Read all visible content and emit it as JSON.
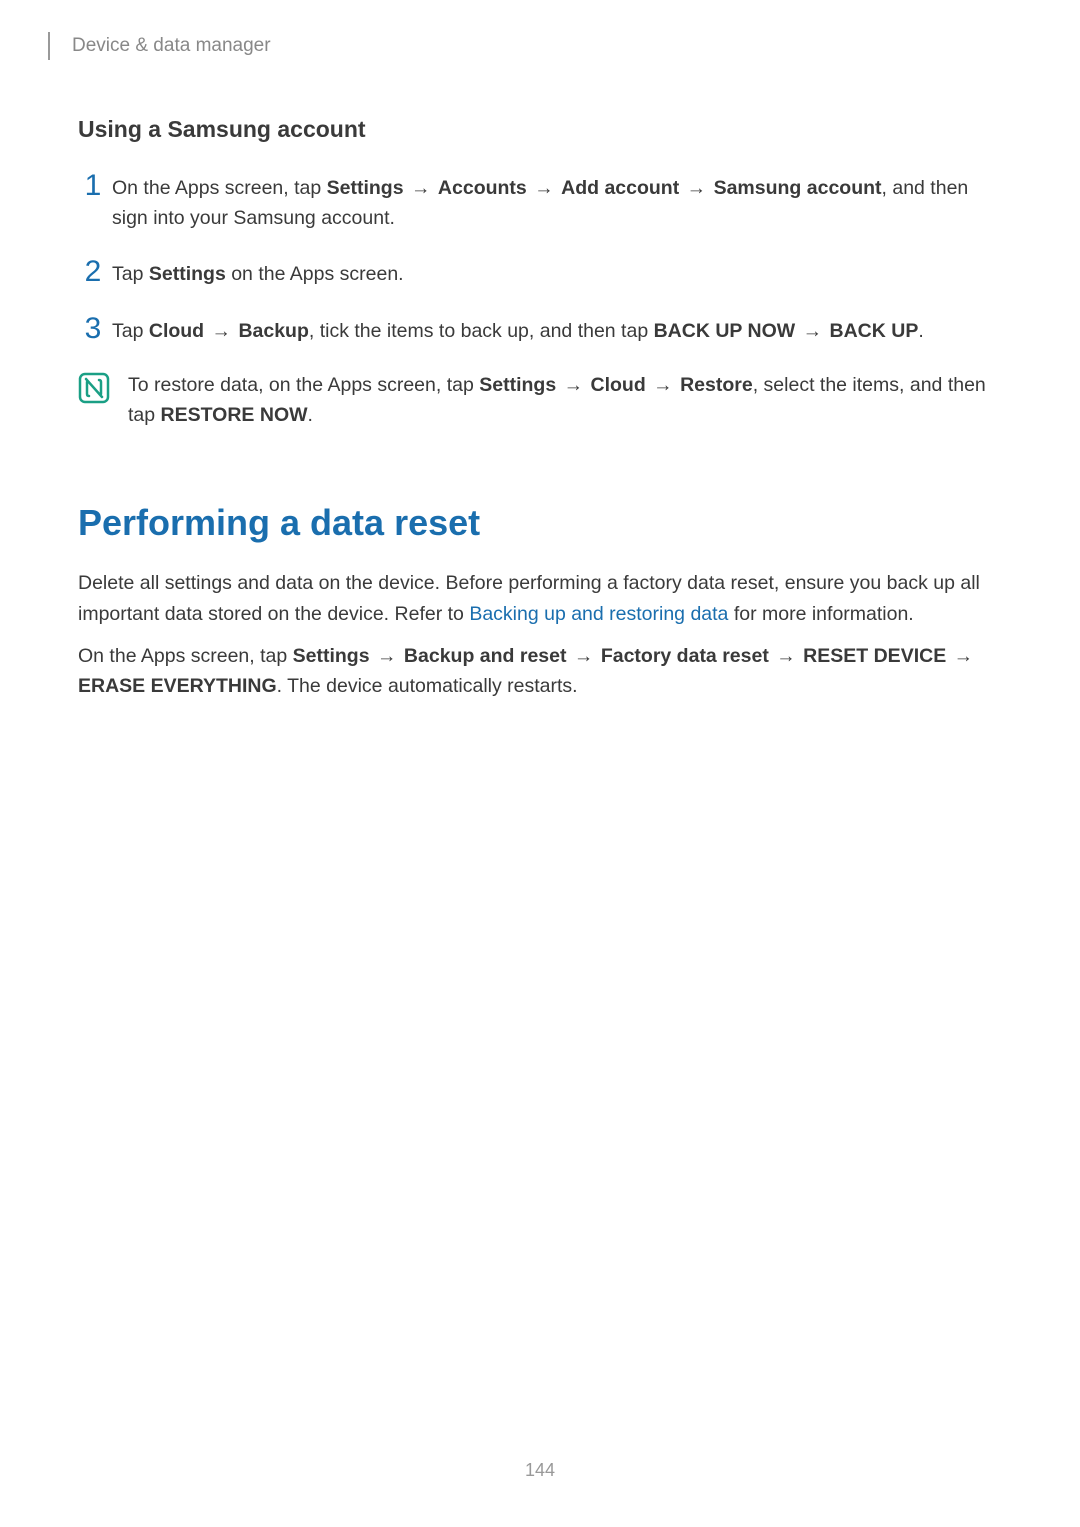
{
  "header": {
    "breadcrumb": "Device & data manager"
  },
  "section1": {
    "subtitle": "Using a Samsung account",
    "steps": [
      {
        "num": "1",
        "parts": [
          {
            "t": "On the Apps screen, tap "
          },
          {
            "t": "Settings",
            "b": true
          },
          {
            "t": " → ",
            "arrow": true
          },
          {
            "t": "Accounts",
            "b": true
          },
          {
            "t": " → ",
            "arrow": true
          },
          {
            "t": "Add account",
            "b": true
          },
          {
            "t": " → ",
            "arrow": true
          },
          {
            "t": "Samsung account",
            "b": true
          },
          {
            "t": ", and then sign into your Samsung account."
          }
        ]
      },
      {
        "num": "2",
        "parts": [
          {
            "t": "Tap "
          },
          {
            "t": "Settings",
            "b": true
          },
          {
            "t": " on the Apps screen."
          }
        ]
      },
      {
        "num": "3",
        "parts": [
          {
            "t": "Tap "
          },
          {
            "t": "Cloud",
            "b": true
          },
          {
            "t": " → ",
            "arrow": true
          },
          {
            "t": "Backup",
            "b": true
          },
          {
            "t": ", tick the items to back up, and then tap "
          },
          {
            "t": "BACK UP NOW",
            "b": true
          },
          {
            "t": " → ",
            "arrow": true
          },
          {
            "t": "BACK UP",
            "b": true
          },
          {
            "t": "."
          }
        ]
      }
    ],
    "note": {
      "parts": [
        {
          "t": "To restore data, on the Apps screen, tap "
        },
        {
          "t": "Settings",
          "b": true
        },
        {
          "t": " → ",
          "arrow": true
        },
        {
          "t": "Cloud",
          "b": true
        },
        {
          "t": " → ",
          "arrow": true
        },
        {
          "t": "Restore",
          "b": true
        },
        {
          "t": ", select the items, and then tap "
        },
        {
          "t": "RESTORE NOW",
          "b": true
        },
        {
          "t": "."
        }
      ]
    }
  },
  "section2": {
    "title": "Performing a data reset",
    "para1": {
      "parts": [
        {
          "t": "Delete all settings and data on the device. Before performing a factory data reset, ensure you back up all important data stored on the device. Refer to "
        },
        {
          "t": "Backing up and restoring data",
          "link": true
        },
        {
          "t": " for more information."
        }
      ]
    },
    "para2": {
      "parts": [
        {
          "t": "On the Apps screen, tap "
        },
        {
          "t": "Settings",
          "b": true
        },
        {
          "t": " → ",
          "arrow": true
        },
        {
          "t": "Backup and reset",
          "b": true
        },
        {
          "t": " → ",
          "arrow": true
        },
        {
          "t": "Factory data reset",
          "b": true
        },
        {
          "t": " → ",
          "arrow": true
        },
        {
          "t": "RESET DEVICE",
          "b": true
        },
        {
          "t": " → ",
          "arrow": true
        },
        {
          "t": "ERASE EVERYTHING",
          "b": true
        },
        {
          "t": ". The device automatically restarts."
        }
      ]
    }
  },
  "page_number": "144"
}
